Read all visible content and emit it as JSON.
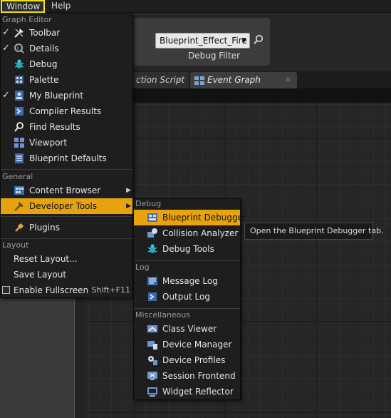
{
  "menubar": {
    "window_label": "Window",
    "help_label": "Help"
  },
  "toolbar": {
    "debug_combo_value": "Blueprint_Effect_Fire",
    "debug_filter_label": "Debug Filter"
  },
  "tabs": [
    {
      "label": "ction Script",
      "close": "×"
    },
    {
      "label": "Event Graph",
      "close": "×"
    }
  ],
  "main_menu": {
    "section_graph_editor": "Graph Editor",
    "items_graph": [
      {
        "label": "Toolbar",
        "checked": true,
        "icon": "toolbar-icon"
      },
      {
        "label": "Details",
        "checked": true,
        "icon": "details-icon"
      },
      {
        "label": "Debug",
        "checked": false,
        "icon": "debug-icon"
      },
      {
        "label": "Palette",
        "checked": false,
        "icon": "palette-icon"
      },
      {
        "label": "My Blueprint",
        "checked": true,
        "icon": "my-blueprint-icon"
      },
      {
        "label": "Compiler Results",
        "checked": false,
        "icon": "compiler-results-icon"
      },
      {
        "label": "Find Results",
        "checked": false,
        "icon": "find-results-icon"
      },
      {
        "label": "Viewport",
        "checked": false,
        "icon": "viewport-icon"
      },
      {
        "label": "Blueprint Defaults",
        "checked": false,
        "icon": "blueprint-defaults-icon"
      }
    ],
    "section_general": "General",
    "content_browser": "Content Browser",
    "developer_tools": "Developer Tools",
    "plugins": "Plugins",
    "section_layout": "Layout",
    "reset_layout": "Reset Layout...",
    "save_layout": "Save Layout",
    "enable_fullscreen": "Enable Fullscreen",
    "fullscreen_shortcut": "Shift+F11"
  },
  "sub_menu": {
    "section_debug": "Debug",
    "blueprint_debugger": "Blueprint Debugger",
    "collision_analyzer": "Collision Analyzer",
    "debug_tools": "Debug Tools",
    "section_log": "Log",
    "message_log": "Message Log",
    "output_log": "Output Log",
    "section_misc": "Miscellaneous",
    "class_viewer": "Class Viewer",
    "device_manager": "Device Manager",
    "device_profiles": "Device Profiles",
    "session_frontend": "Session Frontend",
    "widget_reflector": "Widget Reflector"
  },
  "tooltip": "Open the Blueprint Debugger tab.",
  "colors": {
    "highlight": "#e6a30e",
    "window_outline": "#f1e20a",
    "menu_bg": "#1e1e1e"
  }
}
